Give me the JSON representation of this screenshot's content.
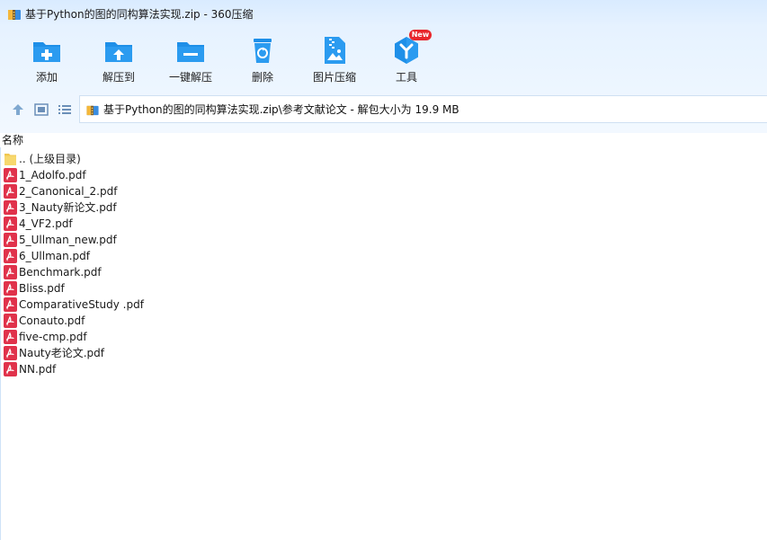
{
  "window": {
    "title": "基于Python的图的同构算法实现.zip - 360压缩"
  },
  "toolbar": {
    "items": [
      {
        "label": "添加",
        "icon": "folder-add-icon"
      },
      {
        "label": "解压到",
        "icon": "folder-extract-icon"
      },
      {
        "label": "一键解压",
        "icon": "folder-oneclick-icon"
      },
      {
        "label": "删除",
        "icon": "recycle-bin-icon"
      },
      {
        "label": "图片压缩",
        "icon": "image-compress-icon"
      },
      {
        "label": "工具",
        "icon": "tools-icon"
      }
    ],
    "new_badge": "New"
  },
  "nav": {
    "path": "基于Python的图的同构算法实现.zip\\参考文献论文 - 解包大小为 19.9 MB"
  },
  "list": {
    "column_name": "名称",
    "files": [
      {
        "name": ".. (上级目录)",
        "type": "folder"
      },
      {
        "name": "1_Adolfo.pdf",
        "type": "pdf"
      },
      {
        "name": "2_Canonical_2.pdf",
        "type": "pdf"
      },
      {
        "name": "3_Nauty新论文.pdf",
        "type": "pdf"
      },
      {
        "name": "4_VF2.pdf",
        "type": "pdf"
      },
      {
        "name": "5_Ullman_new.pdf",
        "type": "pdf"
      },
      {
        "name": "6_Ullman.pdf",
        "type": "pdf"
      },
      {
        "name": "Benchmark.pdf",
        "type": "pdf"
      },
      {
        "name": "Bliss.pdf",
        "type": "pdf"
      },
      {
        "name": "ComparativeStudy .pdf",
        "type": "pdf"
      },
      {
        "name": "Conauto.pdf",
        "type": "pdf"
      },
      {
        "name": "five-cmp.pdf",
        "type": "pdf"
      },
      {
        "name": "Nauty老论文.pdf",
        "type": "pdf"
      },
      {
        "name": "NN.pdf",
        "type": "pdf"
      }
    ]
  },
  "colors": {
    "accent": "#1e8fe8",
    "pdf_red": "#e0324b",
    "folder_yellow": "#f7d36b",
    "badge_red": "#e8262c"
  }
}
